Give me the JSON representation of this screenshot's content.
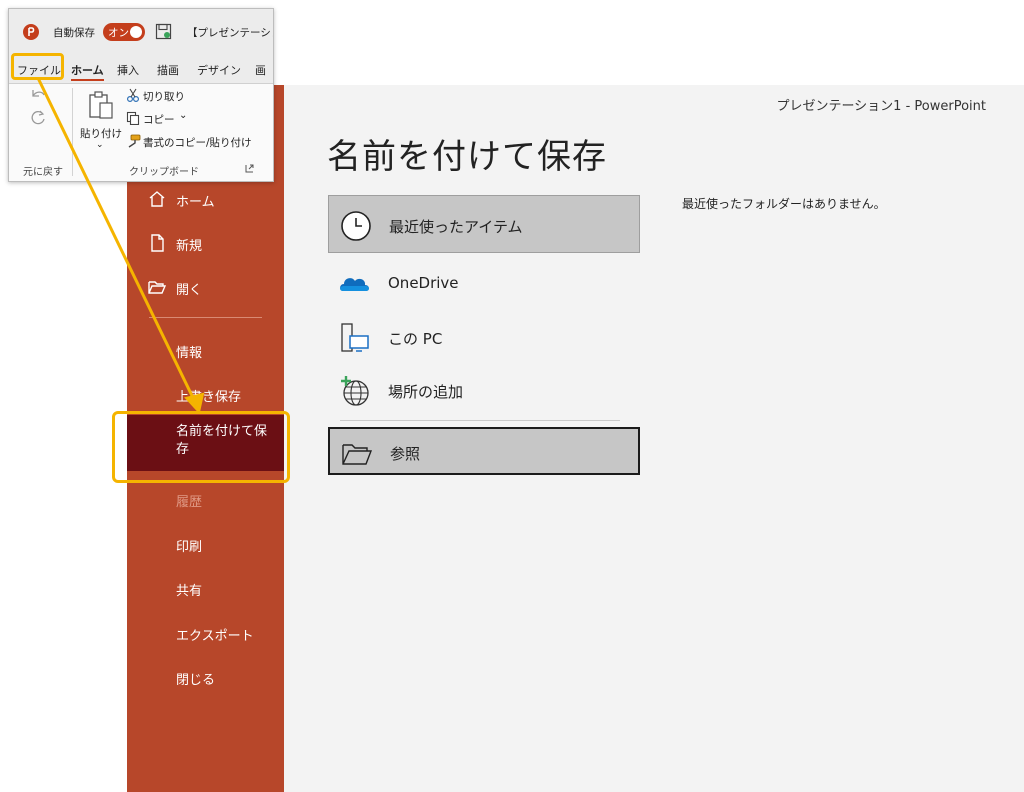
{
  "window": {
    "title": "プレゼンテーション1  -  PowerPoint"
  },
  "page": {
    "title": "名前を付けて保存"
  },
  "sidebar": {
    "items": [
      {
        "label": "ホーム",
        "icon": "home-icon"
      },
      {
        "label": "新規",
        "icon": "new-document-icon"
      },
      {
        "label": "開く",
        "icon": "open-folder-icon"
      },
      {
        "label": "情報"
      },
      {
        "label": "上書き保存"
      },
      {
        "label": "名前を付けて保存",
        "state": "active"
      },
      {
        "label": "履歴",
        "state": "disabled"
      },
      {
        "label": "印刷"
      },
      {
        "label": "共有"
      },
      {
        "label": "エクスポート"
      },
      {
        "label": "閉じる"
      }
    ]
  },
  "locations": [
    {
      "label": "最近使ったアイテム",
      "icon": "clock-icon",
      "state": "selected"
    },
    {
      "label": "OneDrive",
      "icon": "onedrive-cloud-icon"
    },
    {
      "label": "この PC",
      "icon": "this-pc-icon"
    },
    {
      "label": "場所の追加",
      "icon": "add-place-globe-icon"
    },
    {
      "label": "参照",
      "icon": "browse-folder-icon",
      "state": "focused"
    }
  ],
  "recent_folders": {
    "message": "最近使ったフォルダーはありません。"
  },
  "ribbon": {
    "autosave_label": "自動保存",
    "autosave_state": "オン",
    "doc_title": "【プレゼンテーション",
    "tabs": [
      "ファイル",
      "ホーム",
      "挿入",
      "描画",
      "デザイン",
      "画"
    ],
    "active_tab": "ホーム",
    "undo_group_label": "元に戻す",
    "paste_label": "貼り付け",
    "cut_label": "切り取り",
    "copy_label": "コピー",
    "format_painter_label": "書式のコピー/貼り付け",
    "clipboard_group_label": "クリップボード"
  },
  "colors": {
    "accent": "#b7472a",
    "active_item": "#6b0f14",
    "highlight": "#f5b400"
  }
}
